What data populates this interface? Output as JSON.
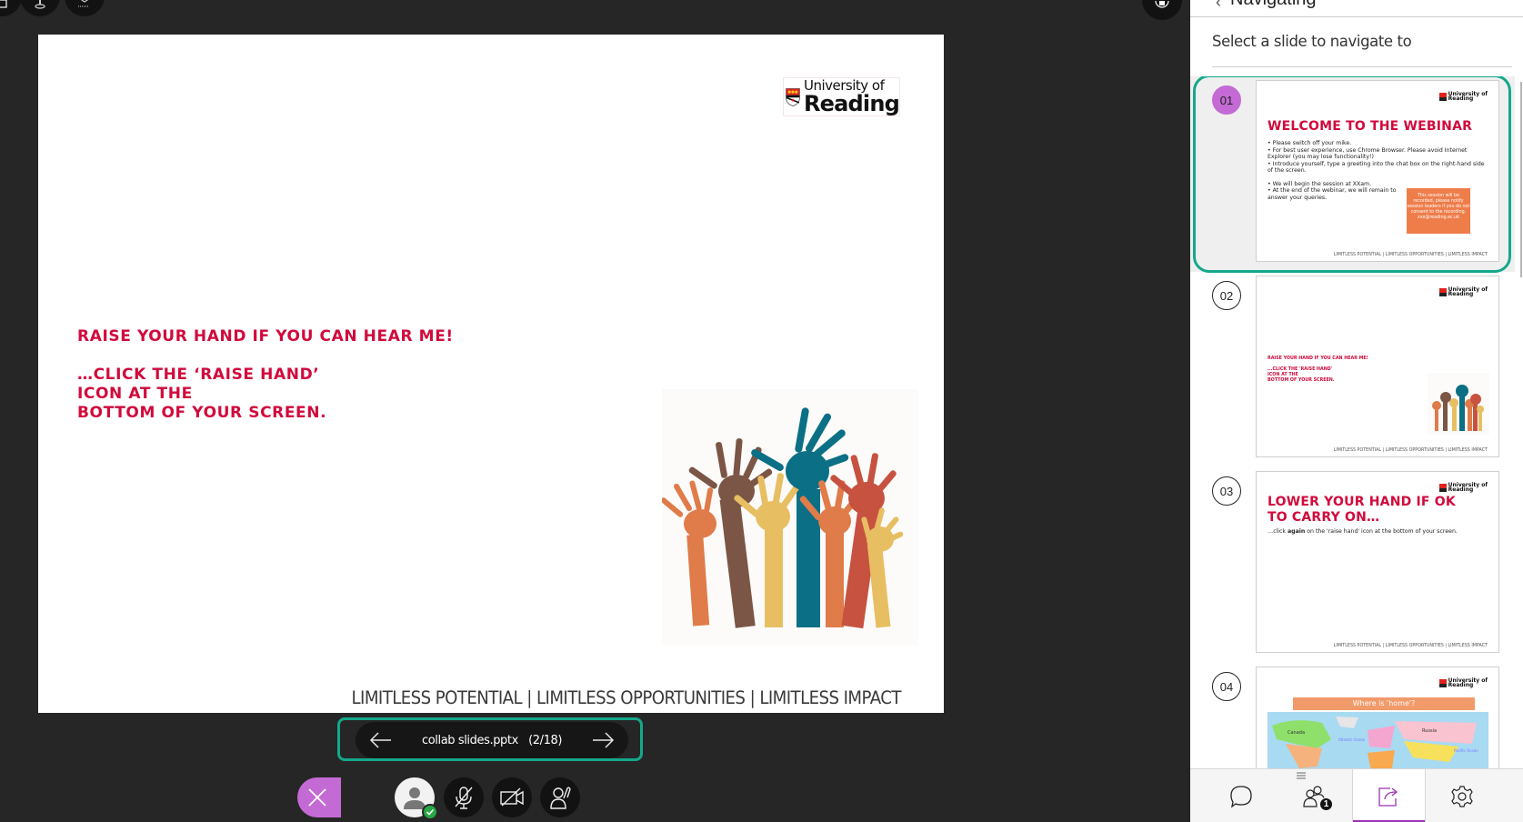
{
  "top_controls": [
    {
      "name": "layout-icon"
    },
    {
      "name": "microphone-stand-icon"
    },
    {
      "name": "share-screen-icon"
    }
  ],
  "slide": {
    "logo": {
      "line1": "University of",
      "line2": "Reading"
    },
    "text_line1": "RAISE YOUR HAND IF YOU CAN HEAR ME!",
    "text_line2": "…CLICK THE ‘RAISE HAND’",
    "text_line3": "ICON AT THE",
    "text_line4": "BOTTOM OF YOUR SCREEN.",
    "footer": "LIMITLESS POTENTIAL  |  LIMITLESS OPPORTUNITIES  |  LIMITLESS IMPACT",
    "image": "raised-hands-illustration"
  },
  "navigator": {
    "file_name": "collab slides.pptx",
    "position": "(2/18)",
    "label": "collab slides.pptx   (2/18)",
    "current_page": 2,
    "total_pages": 18
  },
  "controls": {
    "avatar_status": "connected",
    "mic": "muted",
    "camera": "off",
    "hand": "raise-hand"
  },
  "sidebar": {
    "header_title": "Navigating",
    "prompt": "Select a slide to navigate to",
    "slides": [
      {
        "number": "01",
        "selected": true,
        "title": "WELCOME TO THE WEBINAR",
        "bullets": [
          "Please switch off  your mike.",
          "For best user experience, use Chrome Browser. Please avoid Internet Explorer (you may lose functionality!)",
          "Introduce yourself, type a greeting into the chat box on the right-hand side of the screen.",
          "We will begin the session at XXam.",
          "At the end of the webinar, we will remain to answer your queries."
        ],
        "callout": "This session will be recorded, please notify session leaders if you do not consent to the recording. xxx@reading.ac.uk",
        "footer": "LIMITLESS POTENTIAL | LIMITLESS OPPORTUNITIES | LIMITLESS IMPACT"
      },
      {
        "number": "02",
        "selected": false,
        "line1": "RAISE YOUR HAND IF YOU CAN HEAR ME!",
        "line2": "...CLICK THE 'RAISE HAND'",
        "line3": "ICON AT THE",
        "line4": "BOTTOM OF YOUR SCREEN.",
        "footer": "LIMITLESS POTENTIAL | LIMITLESS OPPORTUNITIES | LIMITLESS IMPACT"
      },
      {
        "number": "03",
        "selected": false,
        "title_line1": "LOWER YOUR HAND IF OK",
        "title_line2": "TO CARRY ON…",
        "body_pre": "…click ",
        "body_bold": "again",
        "body_post": " on the 'raise hand' icon at the bottom of your screen.",
        "footer": "LIMITLESS POTENTIAL | LIMITLESS OPPORTUNITIES | LIMITLESS IMPACT"
      },
      {
        "number": "04",
        "selected": false,
        "banner": "Where is 'home'?",
        "map_labels": [
          "Canada",
          "Russia",
          "Atlantic Ocean",
          "Pacific Ocean"
        ]
      }
    ],
    "toolbar": [
      {
        "name": "chat",
        "icon": "chat-bubble-icon"
      },
      {
        "name": "attendees",
        "icon": "people-icon",
        "badge": "1"
      },
      {
        "name": "share-content",
        "icon": "share-icon",
        "active": true
      },
      {
        "name": "settings",
        "icon": "gear-icon"
      }
    ]
  },
  "colors": {
    "accent_teal": "#14a88a",
    "accent_purple": "#c46ad4",
    "slide_red": "#d10a3c",
    "dark_bg": "#262626"
  }
}
